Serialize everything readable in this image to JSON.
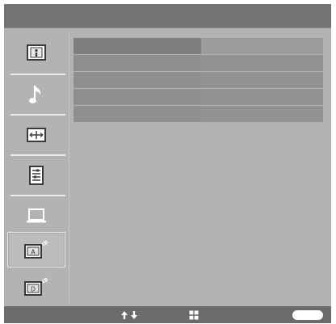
{
  "sidebar": {
    "items": [
      {
        "name": "picture-icon",
        "selected": false
      },
      {
        "name": "music-note-icon",
        "selected": false
      },
      {
        "name": "screen-adjust-icon",
        "selected": false
      },
      {
        "name": "settings-list-icon",
        "selected": false
      },
      {
        "name": "laptop-input-icon",
        "selected": false
      },
      {
        "name": "analog-tv-icon",
        "selected": true
      },
      {
        "name": "digital-tv-icon",
        "selected": false
      }
    ]
  },
  "settings_table": {
    "rows": [
      {
        "label": "",
        "value": ""
      },
      {
        "label": "",
        "value": ""
      },
      {
        "label": "",
        "value": ""
      },
      {
        "label": "",
        "value": ""
      },
      {
        "label": "",
        "value": ""
      }
    ]
  },
  "statusbar": {
    "hints": [
      {
        "icon": "up-down-arrows-icon"
      },
      {
        "icon": "enter-button-icon"
      },
      {
        "icon": "return-button-icon"
      }
    ]
  },
  "colors": {
    "titlebar": "#737373",
    "panel": "#b3b3b3",
    "statusbar": "#6b6b6b",
    "row": "#8f8f8f"
  }
}
